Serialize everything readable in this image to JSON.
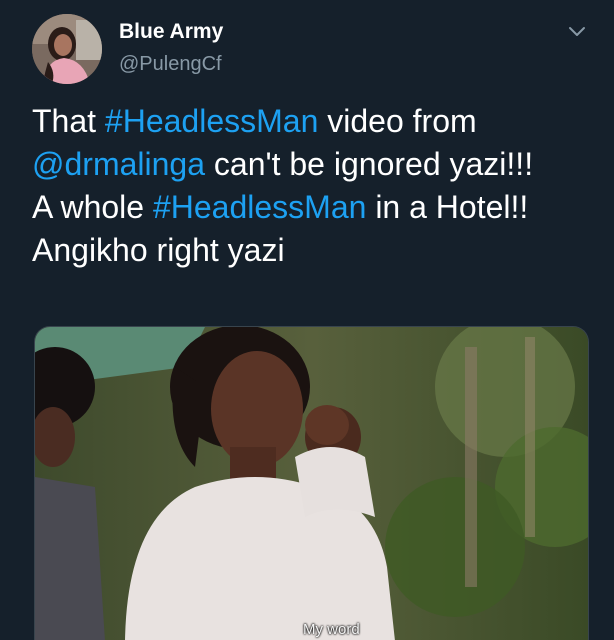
{
  "tweet": {
    "display_name": "Blue Army",
    "handle": "@PulengCf",
    "text_lines": [
      [
        {
          "text": "That ",
          "type": "text"
        },
        {
          "text": "#HeadlessMan",
          "type": "hashtag"
        },
        {
          "text": " video from",
          "type": "text"
        }
      ],
      [
        {
          "text": "@drmalinga",
          "type": "mention"
        },
        {
          "text": " can't be ignored yazi!!!",
          "type": "text"
        }
      ],
      [
        {
          "text": "A whole ",
          "type": "text"
        },
        {
          "text": "#HeadlessMan",
          "type": "hashtag"
        },
        {
          "text": " in a Hotel!!",
          "type": "text"
        }
      ],
      [
        {
          "text": "Angikho right yazi",
          "type": "text"
        }
      ]
    ],
    "media": {
      "caption": "My word"
    }
  },
  "colors": {
    "background": "#15202b",
    "link": "#1da1f2",
    "secondary_text": "#8899a6",
    "primary_text": "#ffffff"
  },
  "icons": {
    "menu": "chevron-down-icon"
  }
}
